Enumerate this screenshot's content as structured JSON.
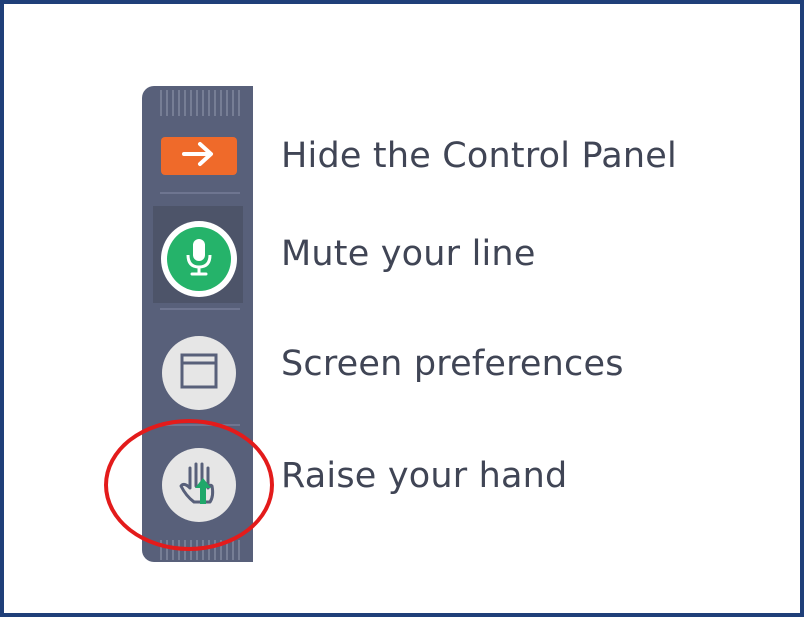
{
  "control_panel": {
    "items": [
      {
        "label": "Hide the Control Panel",
        "icon": "arrow-right-icon",
        "color": "#ef6a2a"
      },
      {
        "label": "Mute your line",
        "icon": "microphone-icon",
        "color": "#25b36a"
      },
      {
        "label": "Screen preferences",
        "icon": "window-icon",
        "color": "#e6e6e6"
      },
      {
        "label": "Raise your hand",
        "icon": "raise-hand-icon",
        "color": "#1fa86a"
      }
    ]
  },
  "annotation": {
    "shape": "circle",
    "color": "#e31b1b",
    "highlights": "raise-hand-button"
  },
  "colors": {
    "panel": "#58607a",
    "border": "#1f3f79",
    "text": "#404555"
  }
}
